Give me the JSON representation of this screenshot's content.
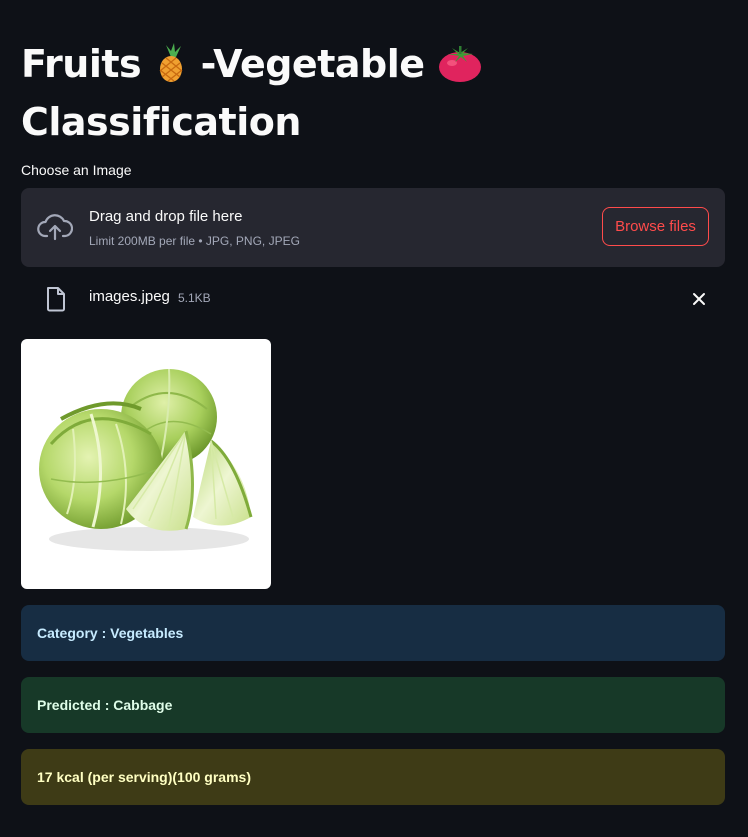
{
  "title": {
    "part1": "Fruits",
    "emoji1": "pineapple-icon",
    "part2": "-Vegetable",
    "emoji2": "tomato-icon",
    "line2": "Classification"
  },
  "uploader": {
    "label": "Choose an Image",
    "drop_text": "Drag and drop file here",
    "limit_text": "Limit 200MB per file • JPG, PNG, JPEG",
    "browse_label": "Browse files"
  },
  "uploaded_file": {
    "name": "images.jpeg",
    "size": "5.1KB"
  },
  "results": {
    "category": "Category : Vegetables",
    "predicted": "Predicted : Cabbage",
    "calories": "17 kcal (per serving)(100 grams)"
  },
  "colors": {
    "background": "#0e1117",
    "accent": "#ff4b4b",
    "info_bg": "#172d43",
    "success_bg": "#173928",
    "warning_bg": "#3e3b16"
  }
}
